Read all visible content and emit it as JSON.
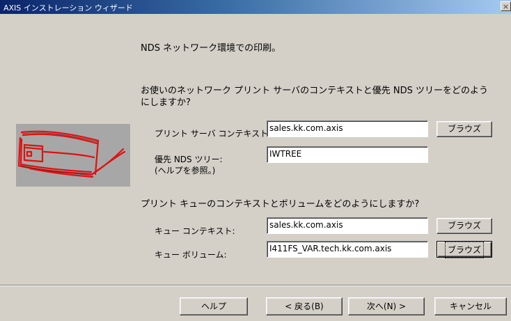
{
  "window": {
    "title": "AXIS インストレーション ウィザード",
    "close_glyph": "×"
  },
  "wizard": {
    "heading": "NDS ネットワーク環境での印刷。",
    "question": "お使いのネットワーク プリント サーバのコンテキストと優先 NDS ツリーをどのようにしますか?",
    "print_server_context_label": "プリント サーバ コンテキスト:",
    "print_server_context_value": "sales.kk.com.axis",
    "preferred_tree_label_line1": "優先 NDS ツリー:",
    "preferred_tree_label_line2": "(ヘルプを参照。)",
    "preferred_tree_value": "IWTREE",
    "queue_question": "プリント キューのコンテキストとボリュームをどのようにしますか?",
    "queue_context_label": "キュー コンテキスト:",
    "queue_context_value": "sales.kk.com.axis",
    "queue_volume_label": "キュー ボリューム:",
    "queue_volume_value": "I411FS_VAR.tech.kk.com.axis",
    "browse_label": "ブラウズ",
    "image_icon": "printer-drawing-icon"
  },
  "footer": {
    "help_label": "ヘルプ",
    "back_label": "< 戻る(B)",
    "next_label": "次へ(N) >",
    "cancel_label": "キャンセル"
  }
}
